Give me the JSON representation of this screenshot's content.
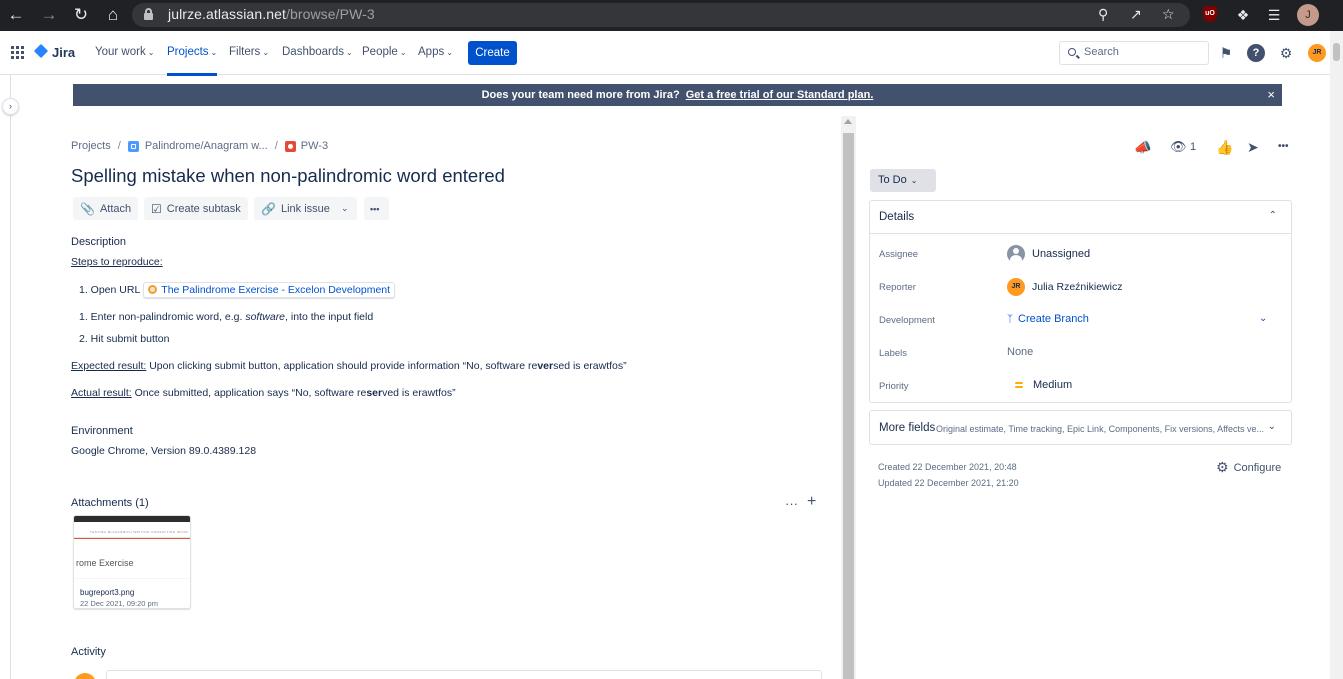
{
  "browser": {
    "url_domain": "julrze.atlassian.net",
    "url_path": "/browse/PW-3",
    "profile_initial": "J",
    "ublock_label": "uO"
  },
  "nav": {
    "product": "Jira",
    "items": [
      "Your work",
      "Projects",
      "Filters",
      "Dashboards",
      "People",
      "Apps"
    ],
    "active": "Projects",
    "create_label": "Create",
    "search_placeholder": "Search",
    "user_initials": "JR"
  },
  "banner": {
    "text": "Does your team need more from Jira?",
    "link": "Get a free trial of our Standard plan.",
    "close": "×"
  },
  "breadcrumb": {
    "root": "Projects",
    "project": "Palindrome/Anagram w...",
    "issue_key": "PW-3"
  },
  "issue": {
    "title": "Spelling mistake when non-palindromic word entered",
    "actions": {
      "attach": "Attach",
      "create_subtask": "Create subtask",
      "link_issue": "Link issue",
      "more": "•••"
    },
    "description": {
      "label": "Description",
      "steps_heading": "Steps to reproduce:",
      "step1_prefix": "1. Open URL",
      "step1_link": "The Palindrome Exercise - Excelon Development",
      "step2_a": "1. Enter non-palindromic word, e.g.",
      "step2_em": "software",
      "step2_b": ", into the input field",
      "step3": "2. Hit submit button",
      "expected_label": "Expected result:",
      "expected_a": "Upon clicking submit button, application should provide information “No, software re",
      "expected_bold": "ver",
      "expected_b": "sed is erawtfos”",
      "actual_label": "Actual result:",
      "actual_a": "Once submitted, application says “No, software re",
      "actual_bold": "ser",
      "actual_b": "ved is erawtfos”"
    },
    "environment": {
      "label": "Environment",
      "value": "Google Chrome, Version 89.0.4389.128"
    },
    "attachments": {
      "label": "Attachments (1)",
      "more": "···",
      "add": "+",
      "file": {
        "preview_text": "rome Exercise",
        "preview_nav": "TESTING  BLACKSMITH  WRITING  CONSULTING  WOTD",
        "name": "bugreport3.png",
        "date": "22 Dec 2021, 09:20 pm"
      }
    },
    "activity_label": "Activity"
  },
  "sidebar": {
    "watch_count": "1",
    "status": "To Do",
    "details_title": "Details",
    "fields": {
      "assignee_label": "Assignee",
      "assignee_value": "Unassigned",
      "reporter_label": "Reporter",
      "reporter_value": "Julia Rzeźnikiewicz",
      "reporter_initials": "JR",
      "development_label": "Development",
      "development_value": "Create Branch",
      "labels_label": "Labels",
      "labels_value": "None",
      "priority_label": "Priority",
      "priority_value": "Medium"
    },
    "more_fields": {
      "title": "More fields",
      "subtitle": "Original estimate, Time tracking, Epic Link, Components, Fix versions, Affects ve..."
    },
    "created": "Created 22 December 2021, 20:48",
    "updated": "Updated 22 December 2021, 21:20",
    "configure": "Configure"
  }
}
